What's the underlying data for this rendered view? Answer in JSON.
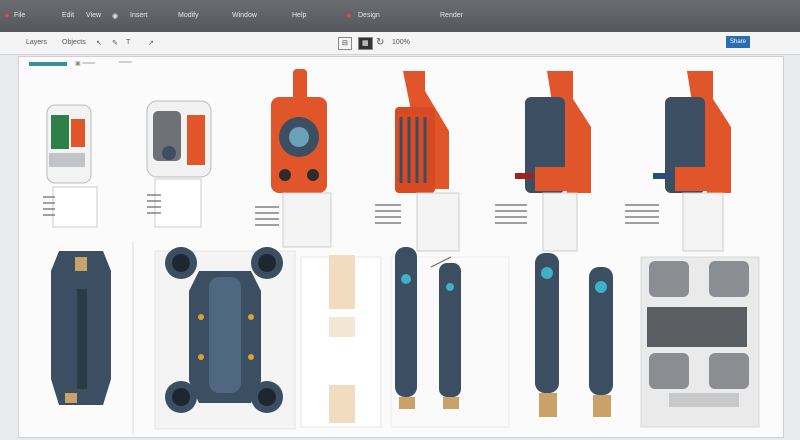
{
  "app": {
    "menu": [
      "File",
      "Edit",
      "View",
      "Insert",
      "Modify",
      "Window",
      "Help",
      "Design",
      "Render"
    ],
    "toolbar_left": [
      "Layers",
      "Objects"
    ],
    "toolbar_icons": [
      "pointer-icon",
      "pen-icon",
      "text-icon",
      "node-icon"
    ],
    "center_buttons": [
      "fit-icon",
      "grid-icon",
      "rotate-icon"
    ],
    "zoom": "100%",
    "share_label": "Share"
  },
  "colors": {
    "orange": "#e0562a",
    "navy": "#3b4e62",
    "cyan": "#3fb0c8",
    "tan": "#f1dcc0",
    "gray": "#6e7276"
  }
}
